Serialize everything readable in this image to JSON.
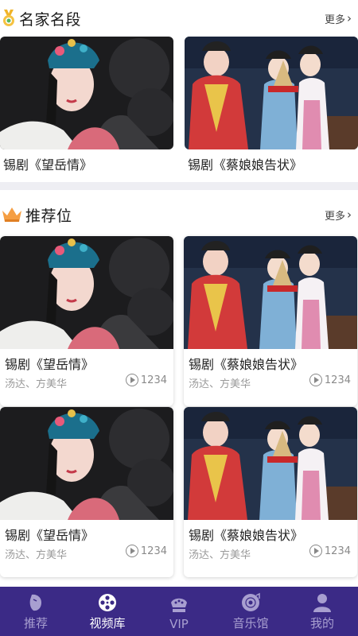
{
  "section1": {
    "title": "名家名段",
    "more": "更多"
  },
  "section2": {
    "title": "推荐位",
    "more": "更多"
  },
  "featured": [
    {
      "title": "锡剧《望岳情》"
    },
    {
      "title": "锡剧《蔡娘娘告状》"
    }
  ],
  "recommended": [
    {
      "title": "锡剧《望岳情》",
      "performers": "汤达、方美华",
      "plays": "1234"
    },
    {
      "title": "锡剧《蔡娘娘告状》",
      "performers": "汤达、方美华",
      "plays": "1234"
    },
    {
      "title": "锡剧《望岳情》",
      "performers": "汤达、方美华",
      "plays": "1234"
    },
    {
      "title": "锡剧《蔡娘娘告状》",
      "performers": "汤达、方美华",
      "plays": "1234"
    }
  ],
  "tabbar": {
    "items": [
      {
        "label": "推荐",
        "icon": "opera-mask-icon"
      },
      {
        "label": "视频库",
        "icon": "film-reel-icon"
      },
      {
        "label": "VIP",
        "icon": "crown-icon"
      },
      {
        "label": "音乐馆",
        "icon": "record-icon"
      },
      {
        "label": "我的",
        "icon": "user-icon"
      }
    ],
    "active": 1,
    "background": "#3b2a86"
  },
  "colors": {
    "accent_gold": "#f0b429",
    "crown_orange": "#f59e42",
    "separator": "#eeeef3"
  }
}
